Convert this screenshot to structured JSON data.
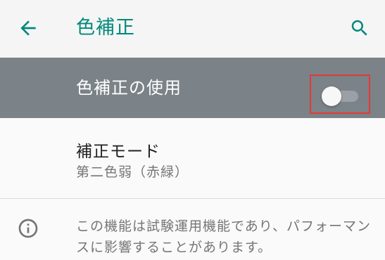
{
  "app_bar": {
    "title": "色補正",
    "back_icon": "arrow-back-icon",
    "search_icon": "search-icon",
    "accent_color": "#00897b"
  },
  "master_switch": {
    "label": "色補正の使用",
    "checked": false,
    "background": "#7b8288"
  },
  "mode": {
    "title": "補正モード",
    "summary": "第二色弱（赤緑）"
  },
  "info": {
    "icon": "info-icon",
    "text": "この機能は試験運用機能であり、パフォーマンスに影響することがあります。"
  }
}
